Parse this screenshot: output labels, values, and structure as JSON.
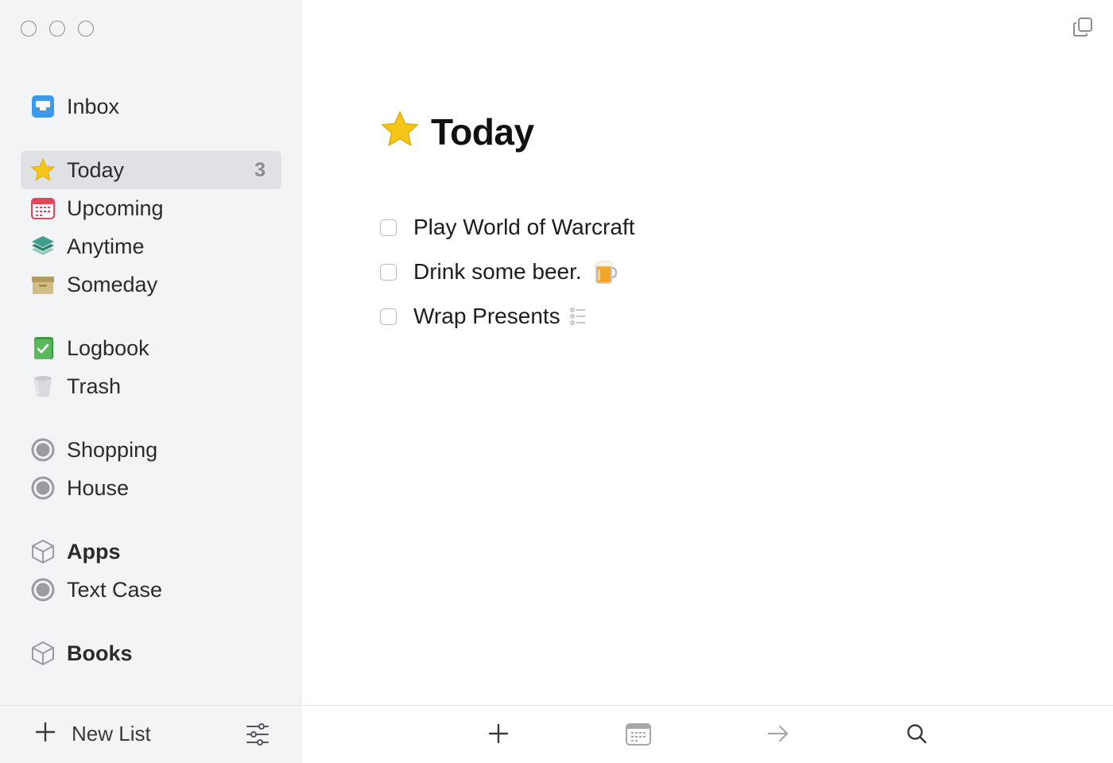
{
  "window": {
    "controls": [
      "close",
      "minimize",
      "zoom"
    ]
  },
  "sidebar": {
    "items": [
      {
        "label": "Inbox",
        "icon": "inbox-icon"
      },
      {
        "label": "Today",
        "icon": "star-icon",
        "count": "3",
        "selected": true
      },
      {
        "label": "Upcoming",
        "icon": "calendar-icon"
      },
      {
        "label": "Anytime",
        "icon": "layers-icon"
      },
      {
        "label": "Someday",
        "icon": "archive-box-icon"
      },
      {
        "label": "Logbook",
        "icon": "logbook-icon"
      },
      {
        "label": "Trash",
        "icon": "trash-icon"
      },
      {
        "label": "Shopping",
        "icon": "area-circle-icon"
      },
      {
        "label": "House",
        "icon": "area-circle-icon"
      },
      {
        "label": "Apps",
        "icon": "cube-icon"
      },
      {
        "label": "Text Case",
        "icon": "area-circle-icon"
      },
      {
        "label": "Books",
        "icon": "cube-icon"
      }
    ],
    "footer": {
      "new_list_label": "New List"
    }
  },
  "main": {
    "title": "Today",
    "tasks": [
      {
        "text": "Play World of Warcraft"
      },
      {
        "text": "Drink some beer.",
        "emoji": "🍺"
      },
      {
        "text": "Wrap Presents",
        "has_checklist": true
      }
    ]
  },
  "colors": {
    "sidebar_bg": "#f3f4f6",
    "selected_bg": "#dfe1e5",
    "star": "#f5c518",
    "inbox": "#3b9bea",
    "calendar": "#e0455a",
    "anytime": "#3f9e8b",
    "someday": "#c9b27a",
    "logbook": "#5cb85c"
  }
}
